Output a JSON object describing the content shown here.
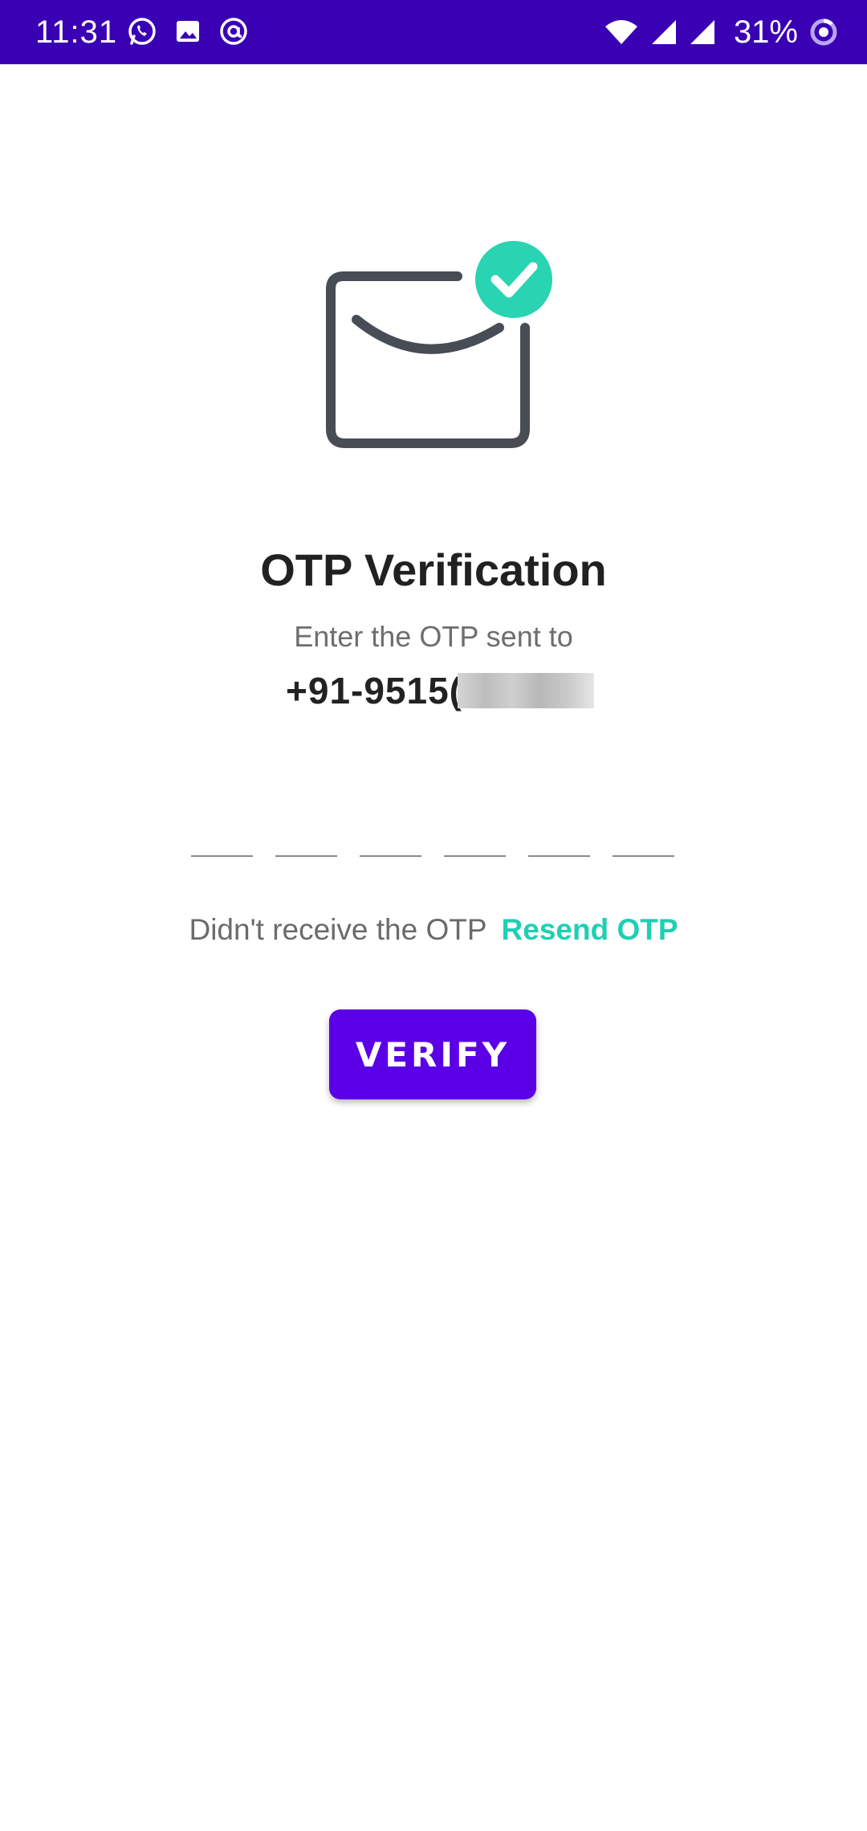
{
  "status_bar": {
    "time": "11:31",
    "battery": "31%",
    "background": "#3a00b3",
    "left_icons": [
      "whatsapp-icon",
      "gallery-icon",
      "at-sign-icon"
    ],
    "right_icons": [
      "wifi-icon",
      "cell-signal-icon",
      "cell-signal-icon",
      "battery-saver-icon"
    ]
  },
  "hero": {
    "icon": "envelope-check-icon",
    "check_color": "#28d4b1",
    "envelope_color": "#474c55"
  },
  "content": {
    "title": "OTP Verification",
    "subtitle": "Enter the OTP sent to",
    "phone_visible": "+91-9515("
  },
  "otp": {
    "digit_count": 6,
    "values": [
      "",
      "",
      "",
      "",
      "",
      ""
    ]
  },
  "resend": {
    "prompt": "Didn't receive the OTP",
    "link": "Resend OTP",
    "link_color": "#1fcfb4"
  },
  "verify": {
    "label": "VERIFY",
    "color": "#5b00e6"
  }
}
